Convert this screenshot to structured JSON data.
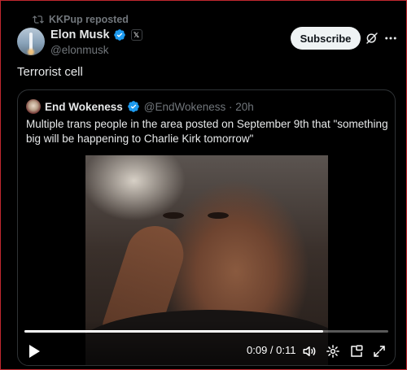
{
  "repost": {
    "label": "KKPup reposted",
    "icon": "repost-icon"
  },
  "author": {
    "name": "Elon Musk",
    "handle": "@elonmusk",
    "affiliation_badge": "𝕏"
  },
  "actions": {
    "subscribe_label": "Subscribe"
  },
  "tweet": {
    "text": "Terrorist cell"
  },
  "quote": {
    "name": "End Wokeness",
    "handle_time": "@EndWokeness · 20h",
    "text": "Multiple trans people in the area posted on September 9th that \"something big will be happening to Charlie Kirk tomorrow\""
  },
  "video": {
    "time": "0:09 / 0:11",
    "progress_fraction": 0.82
  },
  "colors": {
    "accent_verified": "#1d9bf0",
    "subscribe_bg": "#eff3f4",
    "muted_text": "#71767b"
  }
}
